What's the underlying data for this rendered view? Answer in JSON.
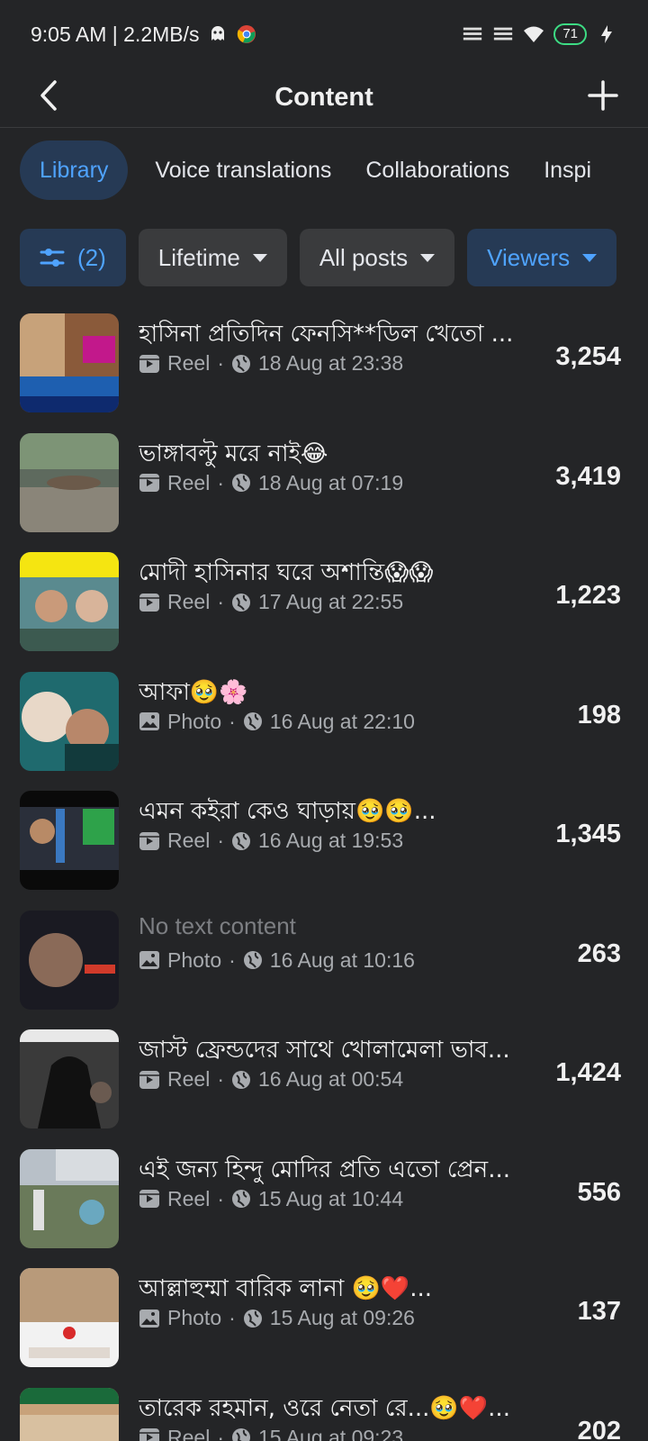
{
  "status_bar": {
    "time_speed": "9:05 AM | 2.2MB/s",
    "battery": "71"
  },
  "header": {
    "title": "Content"
  },
  "tabs": [
    {
      "label": "Library",
      "active": true
    },
    {
      "label": "Voice translations",
      "active": false
    },
    {
      "label": "Collaborations",
      "active": false
    },
    {
      "label": "Inspi",
      "active": false
    }
  ],
  "filters": {
    "settings_count": "(2)",
    "lifetime": "Lifetime",
    "all_posts": "All posts",
    "viewers": "Viewers"
  },
  "colors": {
    "background": "#242527",
    "accent": "#4fa3ff",
    "accent_bg": "#263a55",
    "chip_bg": "#3a3b3d"
  },
  "posts": [
    {
      "title": "হাসিনা প্রতিদিন ফেনসি**ডিল খেতো ...",
      "type": "Reel",
      "date": "18 Aug at 23:38",
      "count": "3,254",
      "icon": "reel-icon"
    },
    {
      "title": "ভাঙ্গাবল্টু মরে নাই😂",
      "type": "Reel",
      "date": "18 Aug at 07:19",
      "count": "3,419",
      "icon": "reel-icon"
    },
    {
      "title": "মোদী হাসিনার ঘরে অশান্তি😱😱",
      "type": "Reel",
      "date": "17 Aug at 22:55",
      "count": "1,223",
      "icon": "reel-icon"
    },
    {
      "title": "আফা🥹🌸",
      "type": "Photo",
      "date": "16 Aug at 22:10",
      "count": "198",
      "icon": "photo-icon"
    },
    {
      "title": "এমন কইরা কেও ঘাড়ায়🥹🥹...",
      "type": "Reel",
      "date": "16 Aug at 19:53",
      "count": "1,345",
      "icon": "reel-icon"
    },
    {
      "title": "No text content",
      "type": "Photo",
      "date": "16 Aug at 10:16",
      "count": "263",
      "icon": "photo-icon"
    },
    {
      "title": "জাস্ট ফ্রেন্ডদের সাথে খোলামেলা ভাব...",
      "type": "Reel",
      "date": "16 Aug at 00:54",
      "count": "1,424",
      "icon": "reel-icon"
    },
    {
      "title": "এই জন্য হিন্দু মোদির প্রতি এতো প্রেন...",
      "type": "Reel",
      "date": "15 Aug at 10:44",
      "count": "556",
      "icon": "reel-icon"
    },
    {
      "title": "আল্লাহুম্মা বারিক লানা 🥹❤️...",
      "type": "Photo",
      "date": "15 Aug at 09:26",
      "count": "137",
      "icon": "photo-icon"
    },
    {
      "title": "তারেক রহমান, ওরে নেতা রে...🥹❤️...",
      "type": "Reel",
      "date": "15 Aug at 09:23",
      "count": "202",
      "icon": "reel-icon"
    }
  ],
  "meta_separator": "·"
}
